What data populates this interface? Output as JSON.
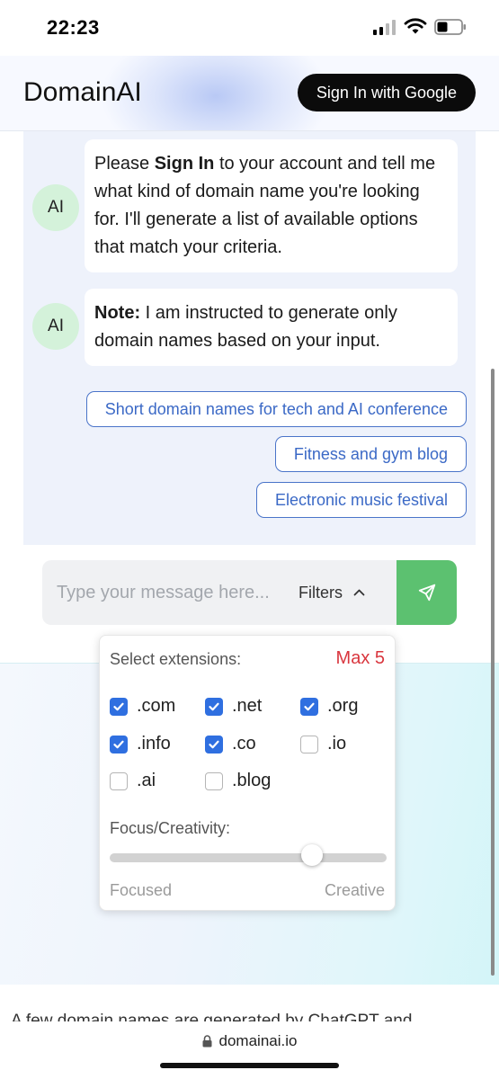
{
  "status_bar": {
    "time": "22:23"
  },
  "header": {
    "brand": "DomainAI",
    "signin_label": "Sign In with Google"
  },
  "messages": [
    {
      "avatar": "AI",
      "parts": [
        {
          "text": "Please "
        },
        {
          "text": "Sign In",
          "bold": true
        },
        {
          "text": " to your account and tell me what kind of domain name you're looking for. I'll generate a list of available options that match your criteria."
        }
      ]
    },
    {
      "avatar": "AI",
      "parts": [
        {
          "text": "Note:",
          "bold": true
        },
        {
          "text": " I am instructed to generate only domain names based on your input."
        }
      ]
    }
  ],
  "suggestions": [
    "Short domain names for tech and AI conference",
    "Fitness and gym blog",
    "Electronic music festival"
  ],
  "composer": {
    "placeholder": "Type your message here...",
    "filters_label": "Filters"
  },
  "filters": {
    "extensions_label": "Select extensions:",
    "max_label": "Max 5",
    "extensions": [
      {
        "name": ".com",
        "checked": true
      },
      {
        "name": ".net",
        "checked": true
      },
      {
        "name": ".org",
        "checked": true
      },
      {
        "name": ".info",
        "checked": true
      },
      {
        "name": ".co",
        "checked": true
      },
      {
        "name": ".io",
        "checked": false
      },
      {
        "name": ".ai",
        "checked": false
      },
      {
        "name": ".blog",
        "checked": false
      }
    ],
    "focus_label": "Focus/Creativity:",
    "slider_value": 0.73,
    "slider_min_label": "Focused",
    "slider_max_label": "Creative"
  },
  "footer": {
    "partial_text": "A few domain names are generated by ChatGPT and",
    "url": "domainai.io"
  },
  "colors": {
    "accent_blue": "#2f6fe0",
    "send_green": "#5cc170",
    "max_red": "#d9363e"
  }
}
